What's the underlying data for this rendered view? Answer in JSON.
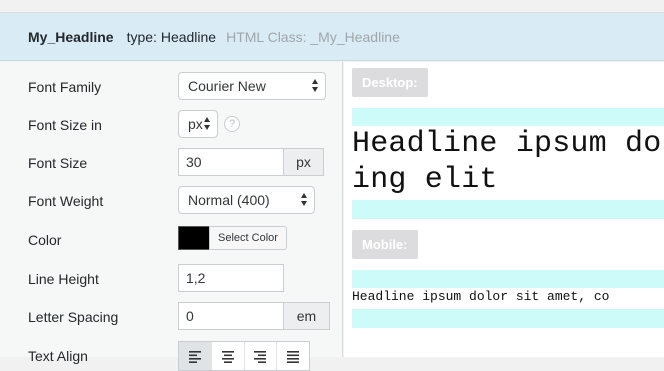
{
  "header": {
    "name": "My_Headline",
    "type_text": "type: Headline",
    "class_text": "HTML Class: _My_Headline"
  },
  "settings": {
    "font_family": {
      "label": "Font Family",
      "value": "Courier New"
    },
    "font_size_in": {
      "label": "Font Size in",
      "value": "px",
      "help": "?"
    },
    "font_size": {
      "label": "Font Size",
      "value": "30",
      "unit": "px"
    },
    "font_weight": {
      "label": "Font Weight",
      "value": "Normal (400)"
    },
    "color": {
      "label": "Color",
      "value": "#000000",
      "button_label": "Select Color"
    },
    "line_height": {
      "label": "Line Height",
      "value": "1,2"
    },
    "letter_spacing": {
      "label": "Letter Spacing",
      "value": "0",
      "unit": "em"
    },
    "text_align": {
      "label": "Text Align",
      "options": [
        "left-align-icon",
        "center-align-icon",
        "right-align-icon",
        "justify-align-icon"
      ],
      "selected": "left"
    }
  },
  "preview": {
    "desktop_label": "Desktop:",
    "desktop_line1": "Headline ipsum dol",
    "desktop_line2": "ing elit",
    "mobile_label": "Mobile:",
    "mobile_text": "Headline ipsum dolor sit amet, co"
  },
  "colors": {
    "header_bg": "#d9ecf5",
    "preview_band": "#ccfbfa",
    "tag_bg": "#dcdcde"
  }
}
